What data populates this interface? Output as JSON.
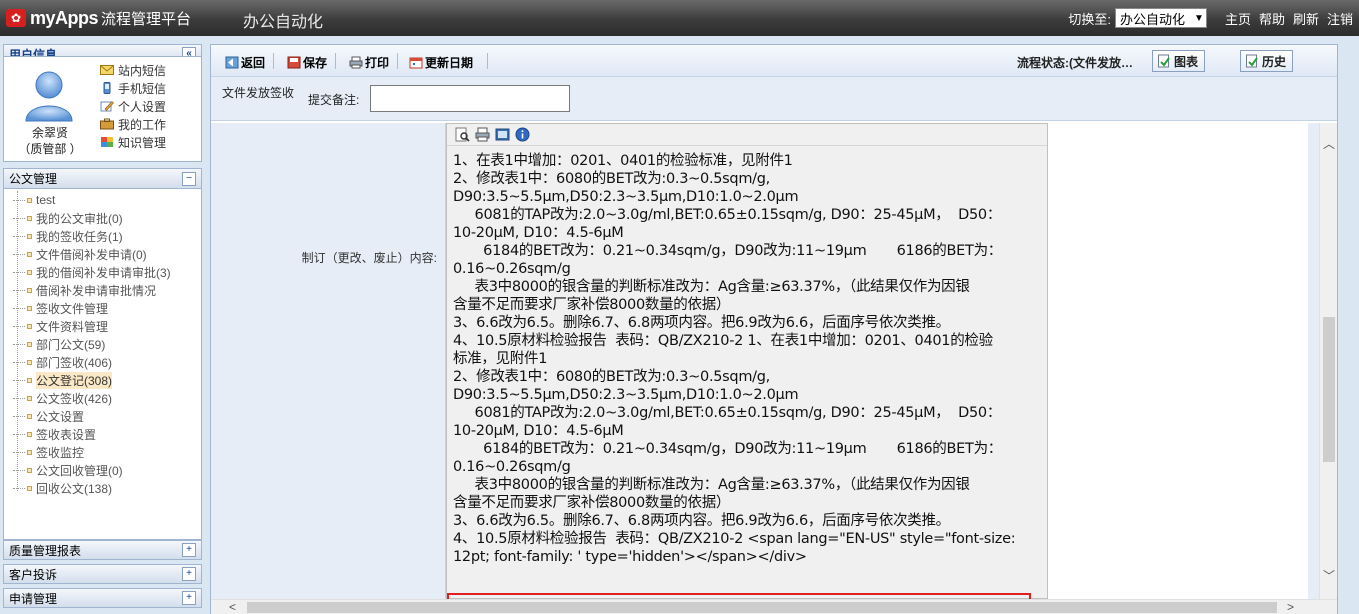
{
  "topbar": {
    "logo_text": "myApps",
    "logo_sub": "流程管理平台",
    "app_title": "办公自动化",
    "switch_label": "切换至:",
    "switch_value": "办公自动化",
    "links": [
      "主页",
      "帮助",
      "刷新",
      "注销"
    ]
  },
  "user": {
    "panel_title": "用户信息",
    "name": "余翠贤",
    "dept": "（质管部 ）",
    "items": [
      "站内短信",
      "手机短信",
      "个人设置",
      "我的工作",
      "知识管理"
    ]
  },
  "docs": {
    "title": "公文管理",
    "items": [
      "test",
      "我的公文审批(0)",
      "我的签收任务(1)",
      "文件借阅补发申请(0)",
      "我的借阅补发申请审批(3)",
      "借阅补发申请审批情况",
      "签收文件管理",
      "文件资料管理",
      "部门公文(59)",
      "部门签收(406)",
      "公文登记(308)",
      "公文签收(426)",
      "公文设置",
      "签收表设置",
      "签收监控",
      "公文回收管理(0)",
      "回收公文(138)"
    ],
    "active_index": 10
  },
  "panels": [
    "质量管理报表",
    "客户投诉",
    "申请管理"
  ],
  "toolbar": {
    "back": "返回",
    "save": "保存",
    "print": "打印",
    "update_date": "更新日期",
    "flow_status": "流程状态:(文件发放…",
    "chart": "图表",
    "history": "历史"
  },
  "form": {
    "title": "文件发放签收",
    "note_label": "提交备注:",
    "note_value": "",
    "content_label": "制订（更改、废止）内容:",
    "content_lines": [
      "1、在表1中增加：0201、0401的检验标准，见附件1",
      "2、修改表1中：6080的BET改为:0.3~0.5sqm/g,",
      "D90:3.5~5.5μm,D50:2.3~3.5μm,D10:1.0~2.0μm",
      "     6081的TAP改为:2.0~3.0g/ml,BET:0.65±0.15sqm/g, D90：25-45μM，  D50：",
      "10-20μM, D10：4.5-6μM",
      "       6184的BET改为：0.21~0.34sqm/g，D90改为:11~19μm       6186的BET为：",
      "0.16~0.26sqm/g",
      "     表3中8000的银含量的判断标准改为：Ag含量:≥63.37%，（此结果仅作为因银",
      "含量不足而要求厂家补偿8000数量的依据）",
      "3、6.6改为6.5。删除6.7、6.8两项内容。把6.9改为6.6，后面序号依次类推。",
      "4、10.5原材料检验报告  表码：QB/ZX210-2 1、在表1中增加：0201、0401的检验",
      "标准，见附件1",
      "2、修改表1中：6080的BET改为:0.3~0.5sqm/g,",
      "D90:3.5~5.5μm,D50:2.3~3.5μm,D10:1.0~2.0μm",
      "     6081的TAP改为:2.0~3.0g/ml,BET:0.65±0.15sqm/g, D90：25-45μM，  D50：",
      "10-20μM, D10：4.5-6μM",
      "       6184的BET改为：0.21~0.34sqm/g，D90改为:11~19μm       6186的BET为：",
      "0.16~0.26sqm/g",
      "     表3中8000的银含量的判断标准改为：Ag含量:≥63.37%，（此结果仅作为因银",
      "含量不足而要求厂家补偿8000数量的依据）",
      "3、6.6改为6.5。删除6.7、6.8两项内容。把6.9改为6.6，后面序号依次类推。",
      "4、10.5原材料检验报告  表码：QB/ZX210-2 <span lang=\"EN-US\" style=\"font-size:",
      "12pt; font-family: ' type='hidden'></span></div>"
    ]
  }
}
